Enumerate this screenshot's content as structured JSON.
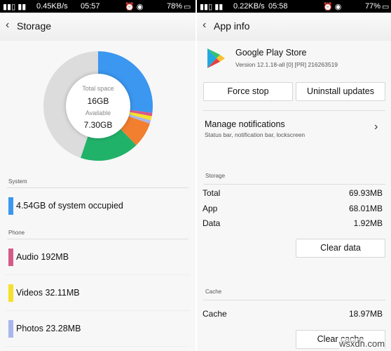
{
  "left": {
    "status": {
      "speed": "0.45KB/s",
      "time": "05:57",
      "battery": "78%"
    },
    "header": {
      "back_icon": "chevron-left-icon",
      "title": "Storage"
    },
    "donut": {
      "total_label": "Total space",
      "total_value": "16GB",
      "available_label": "Available",
      "available_value": "7.30GB",
      "segments": [
        {
          "label": "System",
          "color": "#3b97f0",
          "share": 27
        },
        {
          "label": "Audio",
          "color": "#d65a88",
          "share": 1
        },
        {
          "label": "Videos",
          "color": "#f5e12a",
          "share": 1.2
        },
        {
          "label": "Photos",
          "color": "#a9b6ee",
          "share": 1
        },
        {
          "label": "Other",
          "color": "#f27f2f",
          "share": 7.5
        },
        {
          "label": "Apps",
          "color": "#21b26a",
          "share": 17.5
        },
        {
          "label": "Available",
          "color": "#dcdcdc",
          "share": 44.8
        }
      ]
    },
    "system_section": "System",
    "system_item": {
      "text": "4.54GB of system occupied",
      "color": "#3b97f0"
    },
    "phone_section": "Phone",
    "phone_items": [
      {
        "text": "Audio 192MB",
        "color": "#d65a88"
      },
      {
        "text": "Videos 32.11MB",
        "color": "#f5e12a"
      },
      {
        "text": "Photos 23.28MB",
        "color": "#a9b6ee"
      }
    ]
  },
  "right": {
    "status": {
      "speed": "0.22KB/s",
      "time": "05:58",
      "battery": "77%"
    },
    "header": {
      "back_icon": "chevron-left-icon",
      "title": "App info"
    },
    "app": {
      "name": "Google Play Store",
      "version": "Version 12.1.18-all [0] [PR] 216263519",
      "icon": "play-store-icon"
    },
    "buttons": {
      "force_stop": "Force stop",
      "uninstall_updates": "Uninstall updates"
    },
    "notifications": {
      "title": "Manage notifications",
      "subtitle": "Status bar, notification bar, lockscreen"
    },
    "storage_section": "Storage",
    "storage_rows": [
      {
        "label": "Total",
        "value": "69.93MB"
      },
      {
        "label": "App",
        "value": "68.01MB"
      },
      {
        "label": "Data",
        "value": "1.92MB"
      }
    ],
    "clear_data": "Clear data",
    "cache_section": "Cache",
    "cache_row": {
      "label": "Cache",
      "value": "18.97MB"
    },
    "clear_cache": "Clear cache"
  },
  "watermark": "wsxdn.com"
}
